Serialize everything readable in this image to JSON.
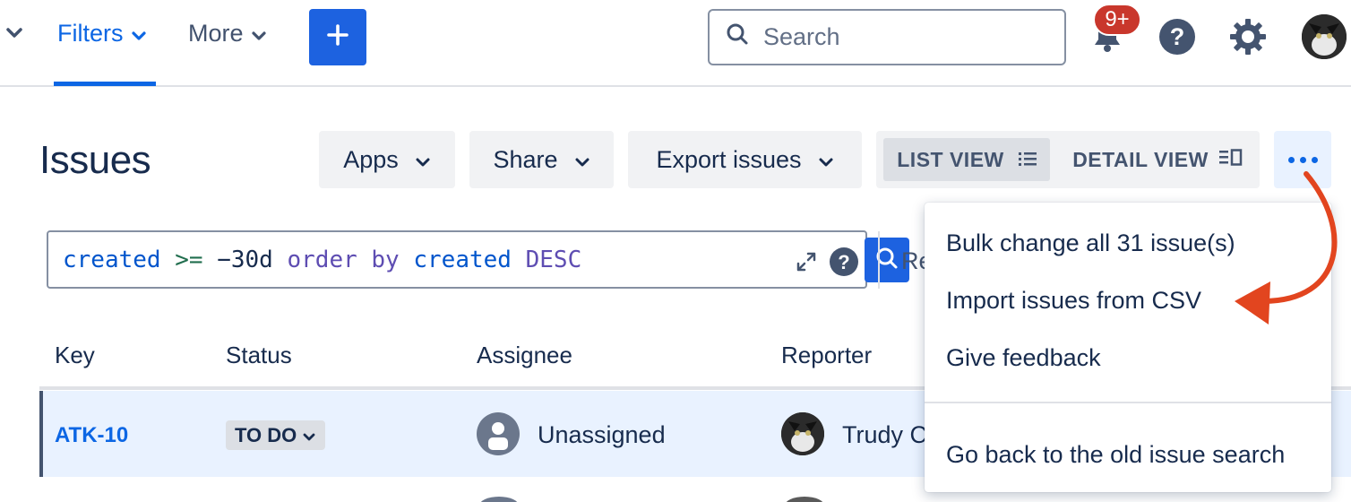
{
  "nav": {
    "filters_label": "Filters",
    "more_label": "More",
    "search_placeholder": "Search",
    "notifications_badge": "9+"
  },
  "header": {
    "title": "Issues",
    "apps_label": "Apps",
    "share_label": "Share",
    "export_label": "Export issues",
    "list_view_label": "LIST VIEW",
    "detail_view_label": "DETAIL VIEW"
  },
  "jql": {
    "field": "created",
    "operator": ">=",
    "value": "−30d",
    "order_by": "order by",
    "order_field": "created",
    "direction": "DESC",
    "side_link": "Re"
  },
  "table": {
    "columns": [
      "Key",
      "Status",
      "Assignee",
      "Reporter"
    ],
    "rows": [
      {
        "key": "ATK-10",
        "status": "TO DO",
        "assignee": "Unassigned",
        "reporter": "Trudy C"
      }
    ]
  },
  "menu": {
    "items": [
      "Bulk change all 31 issue(s)",
      "Import issues from CSV",
      "Give feedback",
      "Go back to the old issue search"
    ]
  },
  "colors": {
    "brand_blue": "#0c66e4",
    "create_button": "#1d62e0",
    "badge_red": "#c9372c",
    "annotation_arrow": "#e2451f"
  }
}
